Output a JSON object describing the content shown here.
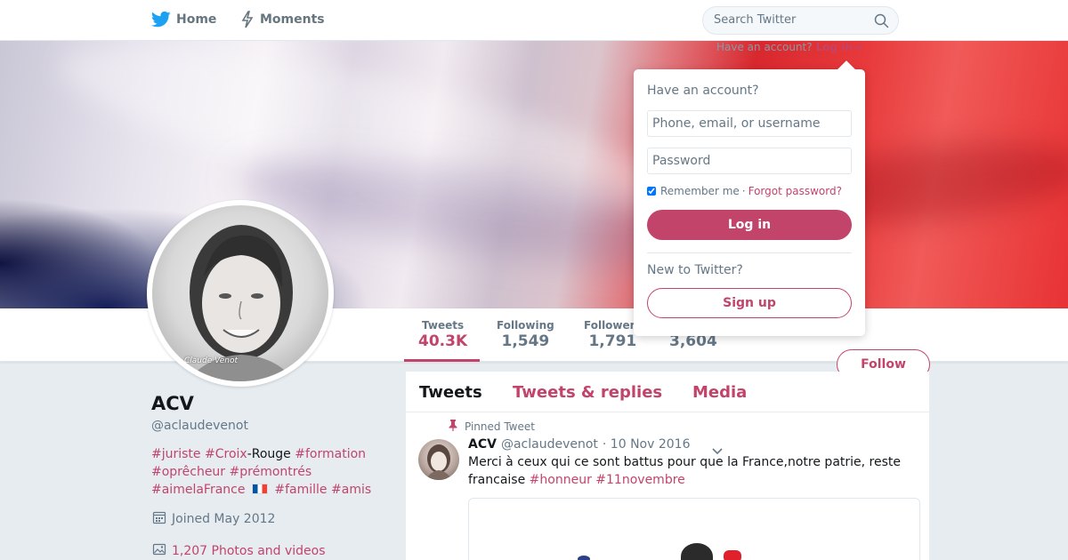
{
  "nav": {
    "home_label": "Home",
    "moments_label": "Moments",
    "search_placeholder": "Search Twitter"
  },
  "account_hint": {
    "text": "Have an account?",
    "login_label": "Log in"
  },
  "stats": {
    "tweets": {
      "label": "Tweets",
      "value": "40.3K"
    },
    "following": {
      "label": "Following",
      "value": "1,549"
    },
    "followers": {
      "label": "Followers",
      "value": "1,791"
    },
    "likes": {
      "value": "3,604"
    }
  },
  "follow_label": "Follow",
  "avatar_signature": "Claude Venot",
  "profile": {
    "name": "ACV",
    "handle": "@aclaudevenot",
    "bio": {
      "t1": "#juriste",
      "t2": "#Croix",
      "t3": "-Rouge",
      "t4": "#formation",
      "t5": "#oprêcheur",
      "t6": "#prémontrés",
      "t7": "#aimelaFrance",
      "t8": "#famille",
      "t9": "#amis"
    },
    "joined": "Joined May 2012",
    "photos": "1,207 Photos and videos"
  },
  "timeline": {
    "tabs": [
      "Tweets",
      "Tweets & replies",
      "Media"
    ],
    "pinned_label": "Pinned Tweet",
    "tweet": {
      "name": "ACV",
      "handle": "@aclaudevenot",
      "date": "· 10 Nov 2016",
      "text": "Merci à ceux qui ce sont battus pour que la France,notre patrie, reste francaise",
      "tag1": "#honneur",
      "tag2": "#11novembre"
    }
  },
  "login_dropdown": {
    "title": "Have an account?",
    "username_placeholder": "Phone, email, or username",
    "password_placeholder": "Password",
    "remember_label": "Remember me",
    "separator": "·",
    "forgot_label": "Forgot password?",
    "login_button": "Log in",
    "new_label": "New to Twitter?",
    "signup_button": "Sign up"
  },
  "colors": {
    "accent": "#c2446b",
    "twitter_blue": "#1da1f2"
  }
}
